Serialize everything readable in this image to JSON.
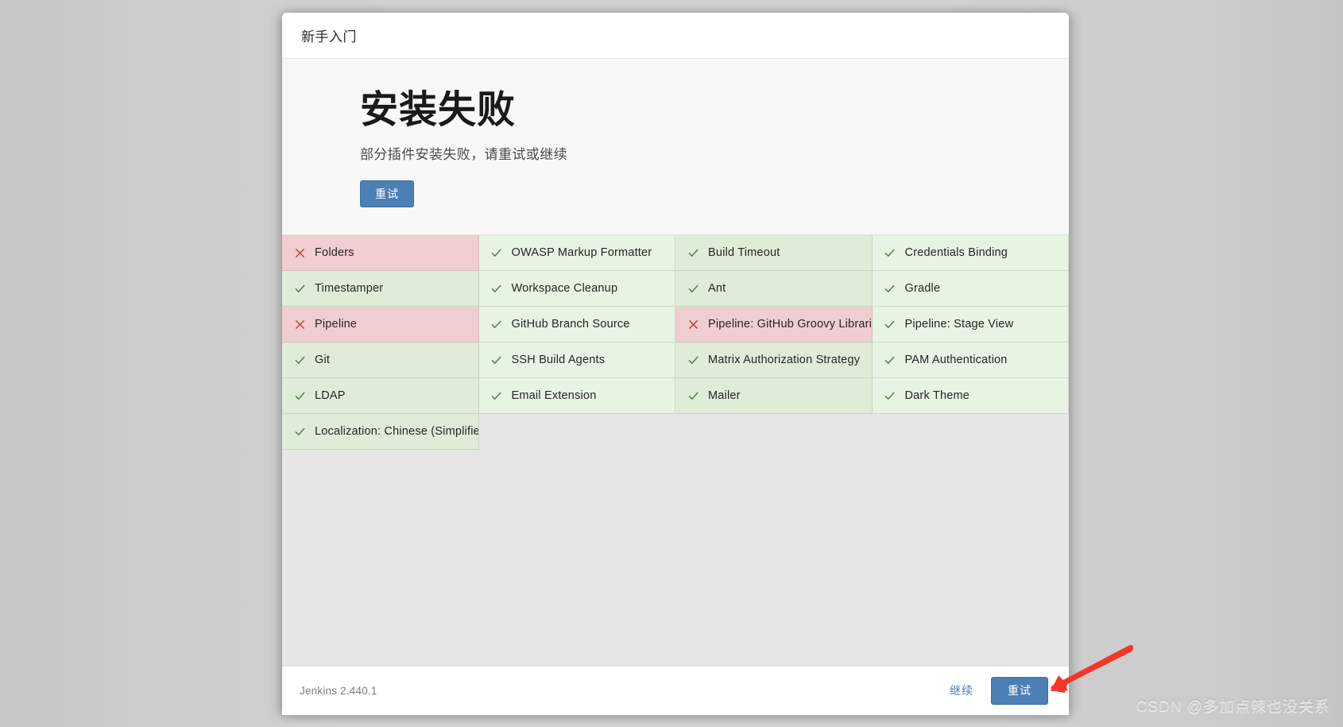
{
  "window": {
    "header_title": "新手入门"
  },
  "hero": {
    "title": "安装失败",
    "subtitle": "部分插件安装失败，请重试或继续",
    "retry_label": "重试"
  },
  "icons": {
    "success": "check-icon",
    "failure": "cross-icon"
  },
  "colors": {
    "primary": "#4b7fb5",
    "success_bg": "#e7f3e3",
    "success_bg_dark": "#dfecd8",
    "failure_bg": "#f2d5d7",
    "failure_bg_dark": "#f0cdd0",
    "check_mark": "#4b7a3c",
    "cross_mark": "#b83a3a",
    "annotation_arrow": "#f5372a"
  },
  "plugins": [
    {
      "name": "Folders",
      "status": "failed"
    },
    {
      "name": "OWASP Markup Formatter",
      "status": "success"
    },
    {
      "name": "Build Timeout",
      "status": "success"
    },
    {
      "name": "Credentials Binding",
      "status": "success"
    },
    {
      "name": "Timestamper",
      "status": "success"
    },
    {
      "name": "Workspace Cleanup",
      "status": "success"
    },
    {
      "name": "Ant",
      "status": "success"
    },
    {
      "name": "Gradle",
      "status": "success"
    },
    {
      "name": "Pipeline",
      "status": "failed"
    },
    {
      "name": "GitHub Branch Source",
      "status": "success"
    },
    {
      "name": "Pipeline: GitHub Groovy Libraries",
      "status": "failed"
    },
    {
      "name": "Pipeline: Stage View",
      "status": "success"
    },
    {
      "name": "Git",
      "status": "success"
    },
    {
      "name": "SSH Build Agents",
      "status": "success"
    },
    {
      "name": "Matrix Authorization Strategy",
      "status": "success"
    },
    {
      "name": "PAM Authentication",
      "status": "success"
    },
    {
      "name": "LDAP",
      "status": "success"
    },
    {
      "name": "Email Extension",
      "status": "success"
    },
    {
      "name": "Mailer",
      "status": "success"
    },
    {
      "name": "Dark Theme",
      "status": "success"
    },
    {
      "name": "Localization: Chinese (Simplified)",
      "status": "success"
    }
  ],
  "footer": {
    "version": "Jenkins 2.440.1",
    "continue_label": "继续",
    "retry_label": "重试"
  },
  "watermark": {
    "text": "CSDN @多加点辣也没关系"
  }
}
